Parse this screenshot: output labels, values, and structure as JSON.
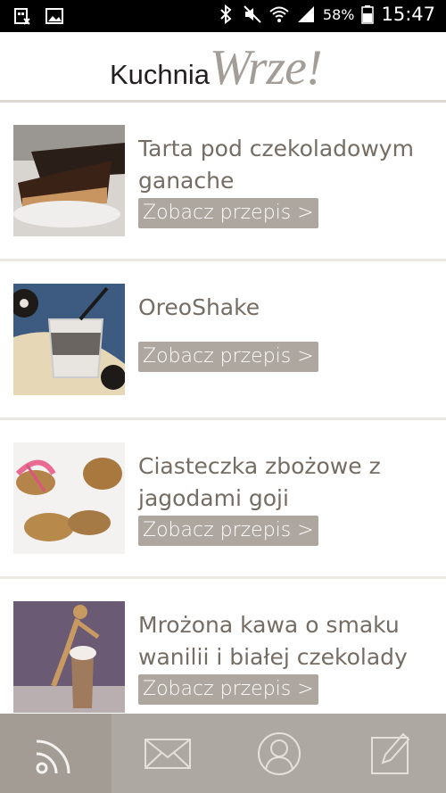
{
  "status_bar": {
    "battery_percent": "58%",
    "time": "15:47",
    "icons": [
      "storage-icon",
      "image-icon",
      "bluetooth-icon",
      "mute-icon",
      "wifi-icon",
      "signal-icon",
      "battery-icon"
    ]
  },
  "header": {
    "logo_part1": "Kuchnia",
    "logo_part2": "Wrze!"
  },
  "recipes": [
    {
      "title": "Tarta pod czekoladowym ganache",
      "button": "Zobacz przepis >"
    },
    {
      "title": "OreoShake",
      "button": "Zobacz przepis >"
    },
    {
      "title": "Ciasteczka zbożowe z jagodami goji",
      "button": "Zobacz przepis >"
    },
    {
      "title": "Mrożona kawa o smaku wanilii i białej czekolady",
      "button": "Zobacz przepis >"
    }
  ],
  "bottom_nav": {
    "items": [
      "rss-icon",
      "mail-icon",
      "profile-icon",
      "edit-icon"
    ],
    "active": "rss-icon"
  },
  "colors": {
    "title_text": "#756c63",
    "button_bg": "#aea7a0",
    "nav_bg": "#aea8a2",
    "logo_accent": "#a49d97"
  }
}
